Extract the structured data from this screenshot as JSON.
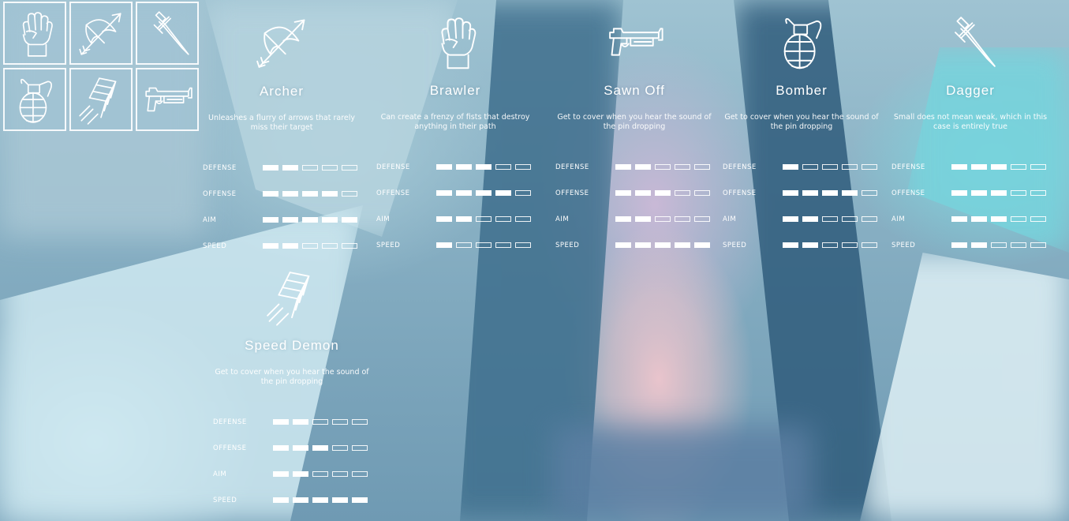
{
  "colors": {
    "accent": "#ffffff",
    "pip_empty_border": "#ffffff"
  },
  "stat_labels": [
    "DEFENSE",
    "OFFENSE",
    "AIM",
    "SPEED"
  ],
  "icon_grid": [
    {
      "icon": "fist-icon"
    },
    {
      "icon": "crossbow-icon"
    },
    {
      "icon": "dagger-icon"
    },
    {
      "icon": "grenade-icon"
    },
    {
      "icon": "speed-chevrons-icon"
    },
    {
      "icon": "shotgun-icon"
    }
  ],
  "characters": [
    {
      "name": "Archer",
      "icon": "crossbow-icon",
      "description": "Unleashes a flurry of arrows that rarely miss their target",
      "stats": {
        "defense": 2,
        "offense": 4,
        "aim": 5,
        "speed": 2
      }
    },
    {
      "name": "Brawler",
      "icon": "fist-icon",
      "description": "Can create a frenzy of fists that destroy anything in their path",
      "stats": {
        "defense": 3,
        "offense": 4,
        "aim": 2,
        "speed": 1
      }
    },
    {
      "name": "Sawn Off",
      "icon": "shotgun-icon",
      "description": "Get to cover when you hear the sound of the pin dropping",
      "stats": {
        "defense": 2,
        "offense": 3,
        "aim": 2,
        "speed": 5
      }
    },
    {
      "name": "Bomber",
      "icon": "grenade-icon",
      "description": "Get to cover when you hear the sound of the pin dropping",
      "stats": {
        "defense": 1,
        "offense": 4,
        "aim": 2,
        "speed": 2
      }
    },
    {
      "name": "Dagger",
      "icon": "dagger-icon",
      "description": "Small does not mean weak, which in this case is entirely true",
      "stats": {
        "defense": 3,
        "offense": 3,
        "aim": 3,
        "speed": 2
      }
    },
    {
      "name": "Speed Demon",
      "icon": "speed-chevrons-icon",
      "description": "Get to cover when you hear the sound of the pin dropping",
      "stats": {
        "defense": 2,
        "offense": 3,
        "aim": 2,
        "speed": 5
      }
    }
  ],
  "pips_total": 5
}
